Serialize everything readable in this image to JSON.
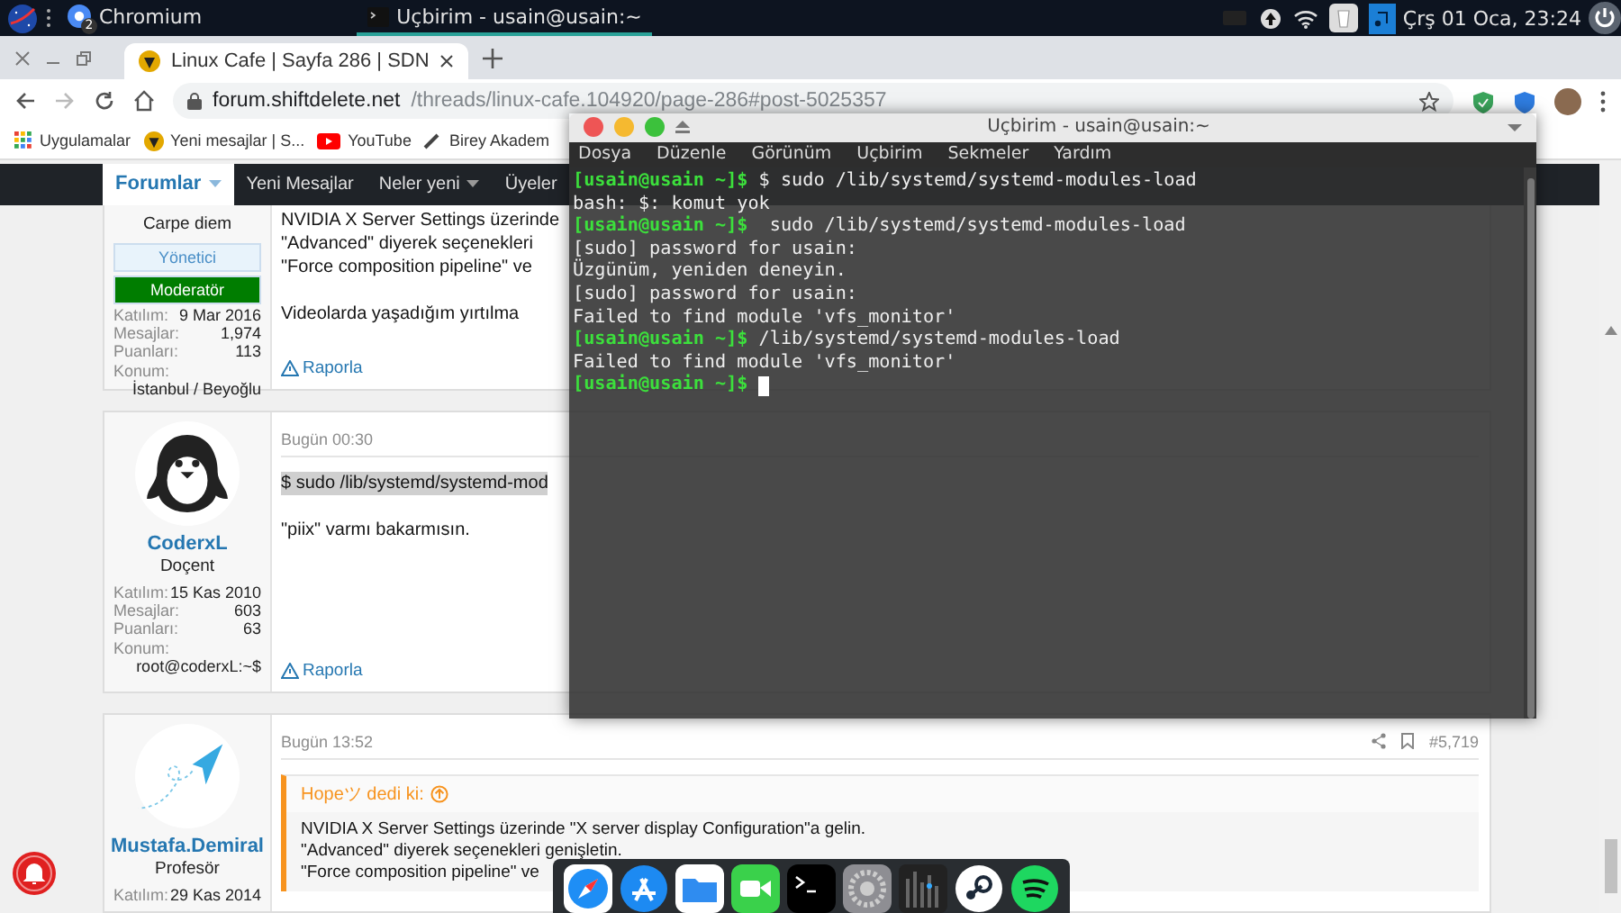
{
  "top_panel": {
    "tasks": [
      {
        "label": "Chromium",
        "badge": "2",
        "kind": "browser",
        "selected": false
      },
      {
        "label": "Uçbirim - usain@usain:~",
        "kind": "terminal",
        "selected": true
      }
    ],
    "clock": "Çrş 01 Oca, 23:24"
  },
  "browser": {
    "tabs": [
      {
        "title": "Linux Cafe | Sayfa 286 | SDN",
        "selected": true
      }
    ],
    "address": {
      "host": "forum.shiftdelete.net",
      "path": "/threads/linux-cafe.104920/page-286#post-5025357"
    },
    "bookmarks": [
      {
        "label": "Uygulamalar",
        "kind": "apps"
      },
      {
        "label": "Yeni mesajlar | S...",
        "kind": "forum"
      },
      {
        "label": "YouTube",
        "kind": "youtube"
      },
      {
        "label": "Birey Akadem",
        "kind": "pen"
      }
    ],
    "nav": [
      {
        "label": "Forumlar",
        "selected": true,
        "dropdown": true
      },
      {
        "label": "Yeni Mesajlar",
        "selected": false,
        "dropdown": false
      },
      {
        "label": "Neler yeni",
        "selected": false,
        "dropdown": true
      },
      {
        "label": "Üyeler",
        "selected": false,
        "dropdown": false
      }
    ],
    "posts": [
      {
        "user": {
          "title": "Carpe diem",
          "badges": [
            {
              "label": "Yönetici",
              "color": "#e8f3fb"
            },
            {
              "label": "Moderatör",
              "color": "#007d00"
            }
          ],
          "stats": [
            {
              "label": "Katılım:",
              "value": "9 Mar 2016"
            },
            {
              "label": "Mesajlar:",
              "value": "1,974"
            },
            {
              "label": "Puanları:",
              "value": "113"
            },
            {
              "label": "Konum:",
              "value": "İstanbul / Beyoğlu"
            }
          ]
        },
        "paragraphs": [
          {
            "lines": [
              "NVIDIA X Server Settings üzerinde",
              "\"Advanced\" diyerek seçenekleri",
              "\"Force composition pipeline\" ve"
            ],
            "highlighted": false
          },
          {
            "lines": [
              "Videolarda yaşadığım yırtılma"
            ],
            "highlighted": false
          }
        ],
        "report": "Raporla"
      },
      {
        "user": {
          "kind": "penguin",
          "name": "CoderxL",
          "title": "Doçent",
          "stats": [
            {
              "label": "Katılım:",
              "value": "15 Kas 2010"
            },
            {
              "label": "Mesajlar:",
              "value": "603"
            },
            {
              "label": "Puanları:",
              "value": "63"
            },
            {
              "label": "Konum:",
              "value": "root@coderxL:~$"
            }
          ]
        },
        "date": "Bugün 00:30",
        "paragraphs": [
          {
            "lines": [
              "$ sudo /lib/systemd/systemd-mod"
            ],
            "highlighted": true
          },
          {
            "lines": [
              "\"piix\" varmı bakarmısın."
            ],
            "highlighted": false
          }
        ],
        "report": "Raporla"
      },
      {
        "user": {
          "kind": "plane",
          "name": "Mustafa.Demiral",
          "title": "Profesör",
          "stats": [
            {
              "label": "Katılım:",
              "value": "29 Kas 2014"
            }
          ]
        },
        "date": "Bugün 13:52",
        "number": "#5,719",
        "quote": {
          "author": "Hopeツ dedi ki:",
          "lines": [
            "NVIDIA X Server Settings üzerinde \"X server display Configuration\"a gelin.",
            "\"Advanced\" diyerek seçenekleri genişletin.",
            "\"Force composition pipeline\" ve"
          ]
        }
      }
    ]
  },
  "terminal": {
    "title": "Uçbirim - usain@usain:~",
    "menu": [
      "Dosya",
      "Düzenle",
      "Görünüm",
      "Uçbirim",
      "Sekmeler",
      "Yardım"
    ],
    "lines": [
      {
        "prompt": "[usain@usain ~]$",
        "text": "$ sudo /lib/systemd/systemd-modules-load"
      },
      {
        "text": "bash: $: komut yok"
      },
      {
        "prompt": "[usain@usain ~]$",
        "text": " sudo /lib/systemd/systemd-modules-load"
      },
      {
        "text": "[sudo] password for usain:"
      },
      {
        "text": "Üzgünüm, yeniden deneyin."
      },
      {
        "text": "[sudo] password for usain:"
      },
      {
        "text": "Failed to find module 'vfs_monitor'"
      },
      {
        "prompt": "[usain@usain ~]$",
        "text": "/lib/systemd/systemd-modules-load"
      },
      {
        "text": "Failed to find module 'vfs_monitor'"
      },
      {
        "prompt": "[usain@usain ~]$"
      }
    ],
    "cursor": true
  }
}
